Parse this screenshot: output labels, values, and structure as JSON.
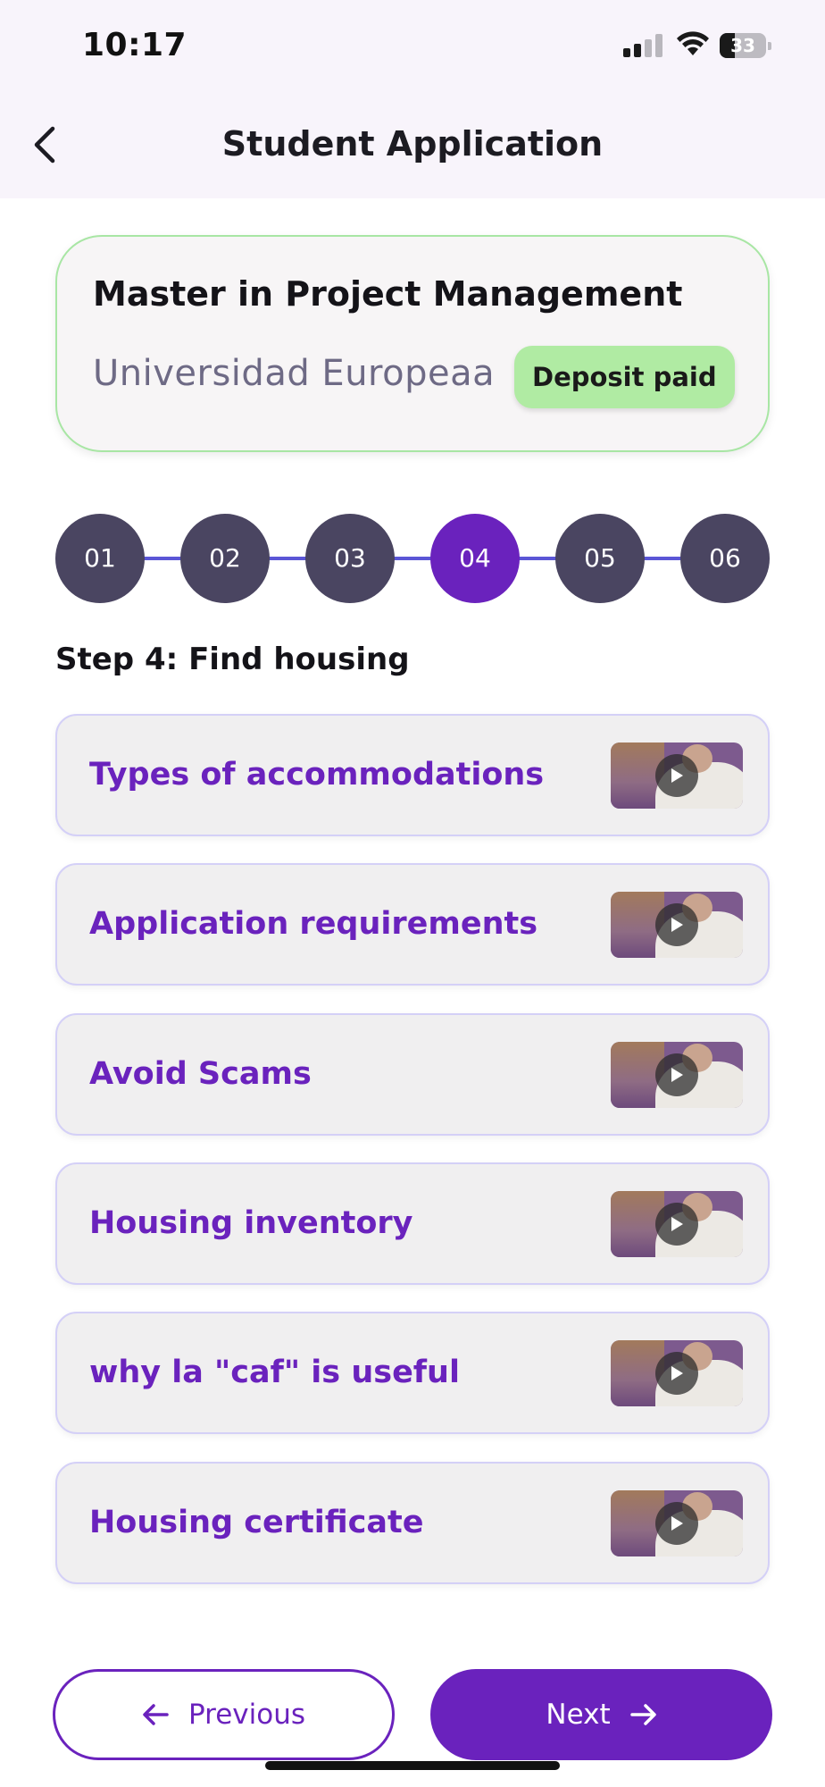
{
  "status_bar": {
    "time": "10:17",
    "battery_level": "33"
  },
  "header": {
    "title": "Student Application",
    "back_icon": "chevron-left-icon"
  },
  "program": {
    "title": "Master in Project Management",
    "university": "Universidad Europeaa",
    "status_badge": "Deposit paid",
    "badge_color": "#b0eba3",
    "border_color": "#a8e6a4"
  },
  "stepper": {
    "steps": [
      "01",
      "02",
      "03",
      "04",
      "05",
      "06"
    ],
    "active_step": "04",
    "active_color": "#6a22bd",
    "inactive_color": "#4a4561"
  },
  "step_heading": "Step 4: Find housing",
  "lessons": [
    {
      "title": "Types of accommodations",
      "thumb_icon": "play-icon"
    },
    {
      "title": "Application requirements",
      "thumb_icon": "play-icon"
    },
    {
      "title": "Avoid Scams",
      "thumb_icon": "play-icon"
    },
    {
      "title": "Housing inventory",
      "thumb_icon": "play-icon"
    },
    {
      "title": "why la \"caf\" is useful",
      "thumb_icon": "play-icon"
    },
    {
      "title": "Housing certificate",
      "thumb_icon": "play-icon"
    }
  ],
  "footer": {
    "previous_label": "Previous",
    "next_label": "Next",
    "accent_color": "#6a22bd"
  }
}
